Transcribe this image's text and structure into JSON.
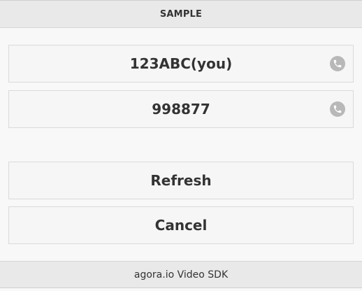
{
  "header": {
    "title": "SAMPLE"
  },
  "users": {
    "items": [
      {
        "label": "123ABC(you)",
        "icon": "phone-icon"
      },
      {
        "label": "998877",
        "icon": "phone-icon"
      }
    ]
  },
  "actions": {
    "refresh_label": "Refresh",
    "cancel_label": "Cancel"
  },
  "footer": {
    "text": "agora.io Video SDK"
  },
  "colors": {
    "bar_bg": "#e9e9e9",
    "content_bg": "#f8f8f8",
    "border": "#dadada",
    "icon_bg": "#b8b8b8",
    "text": "#333333"
  }
}
